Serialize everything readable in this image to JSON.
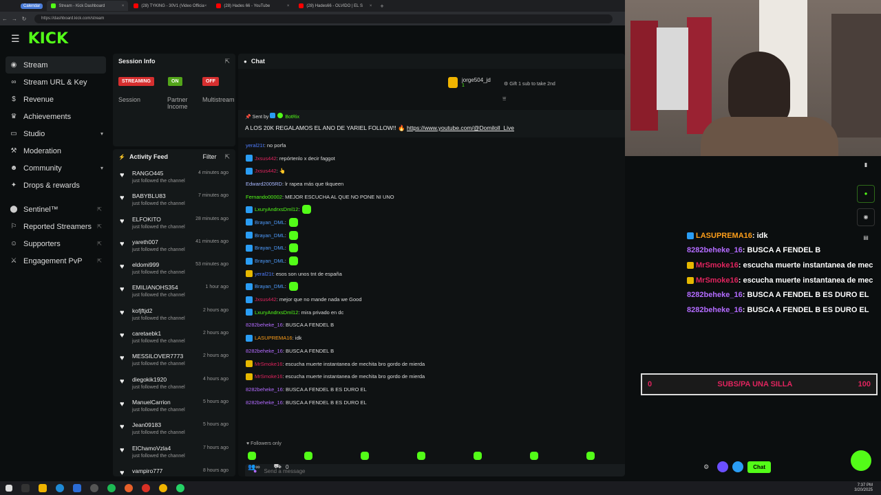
{
  "browser": {
    "calendar_label": "Calendar",
    "tabs": [
      {
        "title": "Stream - Kick Dashboard",
        "color": "#53fc18"
      },
      {
        "title": "(28) TYKING - 30V1 (Video Officia",
        "color": "#ff0000"
      },
      {
        "title": "(28) Hades 66 - YouTube",
        "color": "#ff0000"
      },
      {
        "title": "(28) Hades66 - OLVIDO | EL S",
        "color": "#ff0000"
      }
    ],
    "url": "https://dashboard.kick.com/stream"
  },
  "logo": "KICK",
  "sidebar": {
    "items": [
      {
        "label": "Stream",
        "icon": "broadcast-icon"
      },
      {
        "label": "Stream URL & Key",
        "icon": "link-icon"
      },
      {
        "label": "Revenue",
        "icon": "dollar-icon"
      },
      {
        "label": "Achievements",
        "icon": "trophy-icon"
      },
      {
        "label": "Studio",
        "icon": "monitor-icon"
      },
      {
        "label": "Moderation",
        "icon": "hammer-icon"
      },
      {
        "label": "Community",
        "icon": "users-icon"
      },
      {
        "label": "Drops & rewards",
        "icon": "gift-icon"
      }
    ],
    "external": [
      {
        "label": "Sentinel™"
      },
      {
        "label": "Reported Streamers"
      },
      {
        "label": "Supporters"
      },
      {
        "label": "Engagement PvP"
      }
    ]
  },
  "session": {
    "title": "Session Info",
    "badges": [
      {
        "label": "STREAMING",
        "color": "#d62f2f"
      },
      {
        "label": "ON",
        "color": "#53a51a"
      },
      {
        "label": "OFF",
        "color": "#d62f2f"
      }
    ],
    "stats": [
      "Session",
      "Partner Income",
      "Multistream"
    ]
  },
  "feed": {
    "title": "Activity Feed",
    "filter": "Filter",
    "items": [
      {
        "name": "RANGO445",
        "action": "just followed the channel",
        "time": "4 minutes ago"
      },
      {
        "name": "BABYBLU83",
        "action": "just followed the channel",
        "time": "7 minutes ago"
      },
      {
        "name": "ELFOKITO",
        "action": "just followed the channel",
        "time": "28 minutes ago"
      },
      {
        "name": "yareth007",
        "action": "just followed the channel",
        "time": "41 minutes ago"
      },
      {
        "name": "eldomi999",
        "action": "just followed the channel",
        "time": "53 minutes ago"
      },
      {
        "name": "EMILIANOHS354",
        "action": "just followed the channel",
        "time": "1 hour ago"
      },
      {
        "name": "kofjftjd2",
        "action": "just followed the channel",
        "time": "2 hours ago"
      },
      {
        "name": "caretaebk1",
        "action": "just followed the channel",
        "time": "2 hours ago"
      },
      {
        "name": "MESSILOVER7773",
        "action": "just followed the channel",
        "time": "2 hours ago"
      },
      {
        "name": "diegokik1920",
        "action": "just followed the channel",
        "time": "4 hours ago"
      },
      {
        "name": "ManuelCarrion",
        "action": "just followed the channel",
        "time": "5 hours ago"
      },
      {
        "name": "Jean09183",
        "action": "just followed the channel",
        "time": "5 hours ago"
      },
      {
        "name": "ElChamoVzla4",
        "action": "just followed the channel",
        "time": "7 hours ago"
      },
      {
        "name": "vampiro777",
        "action": "",
        "time": "8 hours ago"
      }
    ]
  },
  "chat": {
    "title": "Chat",
    "top_gifter": {
      "name": "jorge504_jd",
      "count": "1"
    },
    "gift_prompt": "Gift 1 sub to take 2nd",
    "pinned": {
      "sent_by_label": "Sent by",
      "sender": "BotRix",
      "text": "A LOS 20K REGALAMOS EL ANO DE YARIEL FOLLOW!! 🔥",
      "link": "https://www.youtube.com/@Domiloll_Live"
    },
    "messages": [
      {
        "user": "yeral21t",
        "color": "#4f7dff",
        "text": ": no porfa",
        "badge": ""
      },
      {
        "user": "Jxsus442",
        "color": "#e0245e",
        "text": ": repórtenlo x decir faggot",
        "badge": "#2a9df4"
      },
      {
        "user": "Jxsus442",
        "color": "#e0245e",
        "text": ": 👆",
        "badge": "#2a9df4"
      },
      {
        "user": "Edward2005RD",
        "color": "#a9b8ff",
        "text": ": lr rapea más que tkqueen",
        "badge": ""
      },
      {
        "user": "Fernando00002",
        "color": "#53fc18",
        "text": ": MEJOR ESCUCHA AL QUE NO PONE NI UNO",
        "badge": ""
      },
      {
        "user": "LxuryAndrxsDml12",
        "color": "#53fc18",
        "text": ":",
        "badge": "#2a9df4",
        "emote": true
      },
      {
        "user": "Brayan_DML",
        "color": "#4f9dff",
        "text": ":",
        "badge": "#2a9df4",
        "emote": true
      },
      {
        "user": "Brayan_DML",
        "color": "#4f9dff",
        "text": ":",
        "badge": "#2a9df4",
        "emote": true
      },
      {
        "user": "Brayan_DML",
        "color": "#4f9dff",
        "text": ":",
        "badge": "#2a9df4",
        "emote": true
      },
      {
        "user": "Brayan_DML",
        "color": "#4f9dff",
        "text": ":",
        "badge": "#2a9df4",
        "emote": true
      },
      {
        "user": "yeral21t",
        "color": "#4f7dff",
        "text": ": esos son unos tnt de españa",
        "badge": "#e6b800"
      },
      {
        "user": "Brayan_DML",
        "color": "#4f9dff",
        "text": ":",
        "badge": "#2a9df4",
        "emote": true
      },
      {
        "user": "Jxsus442",
        "color": "#e0245e",
        "text": ": mejor que no mande nada we Good",
        "badge": "#2a9df4"
      },
      {
        "user": "LxuryAndrxsDml12",
        "color": "#53fc18",
        "text": ": mira privado en dc",
        "badge": "#2a9df4"
      },
      {
        "user": "8282beheke_16",
        "color": "#b36bff",
        "text": ": BUSCA A FENDEL B",
        "badge": ""
      },
      {
        "user": "LASUPREMA16",
        "color": "#ff9f1a",
        "text": ": idk",
        "badge": "#2a9df4"
      },
      {
        "user": "8282beheke_16",
        "color": "#b36bff",
        "text": ": BUSCA A FENDEL B",
        "badge": ""
      },
      {
        "user": "MrSmoke16",
        "color": "#e0245e",
        "text": ": escucha muerte instantanea de mechita bro gordo de mierda",
        "badge": "#e6b800"
      },
      {
        "user": "MrSmoke16",
        "color": "#e0245e",
        "text": ": escucha muerte instantanea de mechita bro gordo de mierda",
        "badge": "#e6b800"
      },
      {
        "user": "8282beheke_16",
        "color": "#b36bff",
        "text": ": BUSCA A FENDEL B ES DURO EL",
        "badge": ""
      },
      {
        "user": "8282beheke_16",
        "color": "#b36bff",
        "text": ": BUSCA A FENDEL B ES DURO EL",
        "badge": ""
      }
    ],
    "followers_only": "Followers only",
    "placeholder": "Send a message",
    "viewer_count": "0",
    "send_label": "Chat"
  },
  "overlay": {
    "lines": [
      {
        "user": "LASUPREMA16",
        "color": "#ff9f1a",
        "text": " : idk",
        "badge": "#2a9df4"
      },
      {
        "user": "8282beheke_16",
        "color": "#b36bff",
        "text": " : BUSCA A FENDEL B",
        "badge": ""
      },
      {
        "user": "MrSmoke16",
        "color": "#e0245e",
        "text": " : escucha muerte instantanea de mec",
        "badge": "#e6b800"
      },
      {
        "user": "MrSmoke16",
        "color": "#e0245e",
        "text": " : escucha muerte instantanea de mec",
        "badge": "#e6b800"
      },
      {
        "user": "8282beheke_16",
        "color": "#b36bff",
        "text": " : BUSCA A FENDEL B ES DURO EL",
        "badge": ""
      },
      {
        "user": "8282beheke_16",
        "color": "#b36bff",
        "text": " : BUSCA A FENDEL B ES DURO EL",
        "badge": ""
      }
    ],
    "goal": {
      "start": "0",
      "label": "SUBS/PA UNA SILLA",
      "end": "100",
      "progress": 0
    }
  },
  "clock": {
    "time": "7:37 PM",
    "date": "3/20/2025"
  },
  "colors": {
    "brand": "#53fc18"
  }
}
